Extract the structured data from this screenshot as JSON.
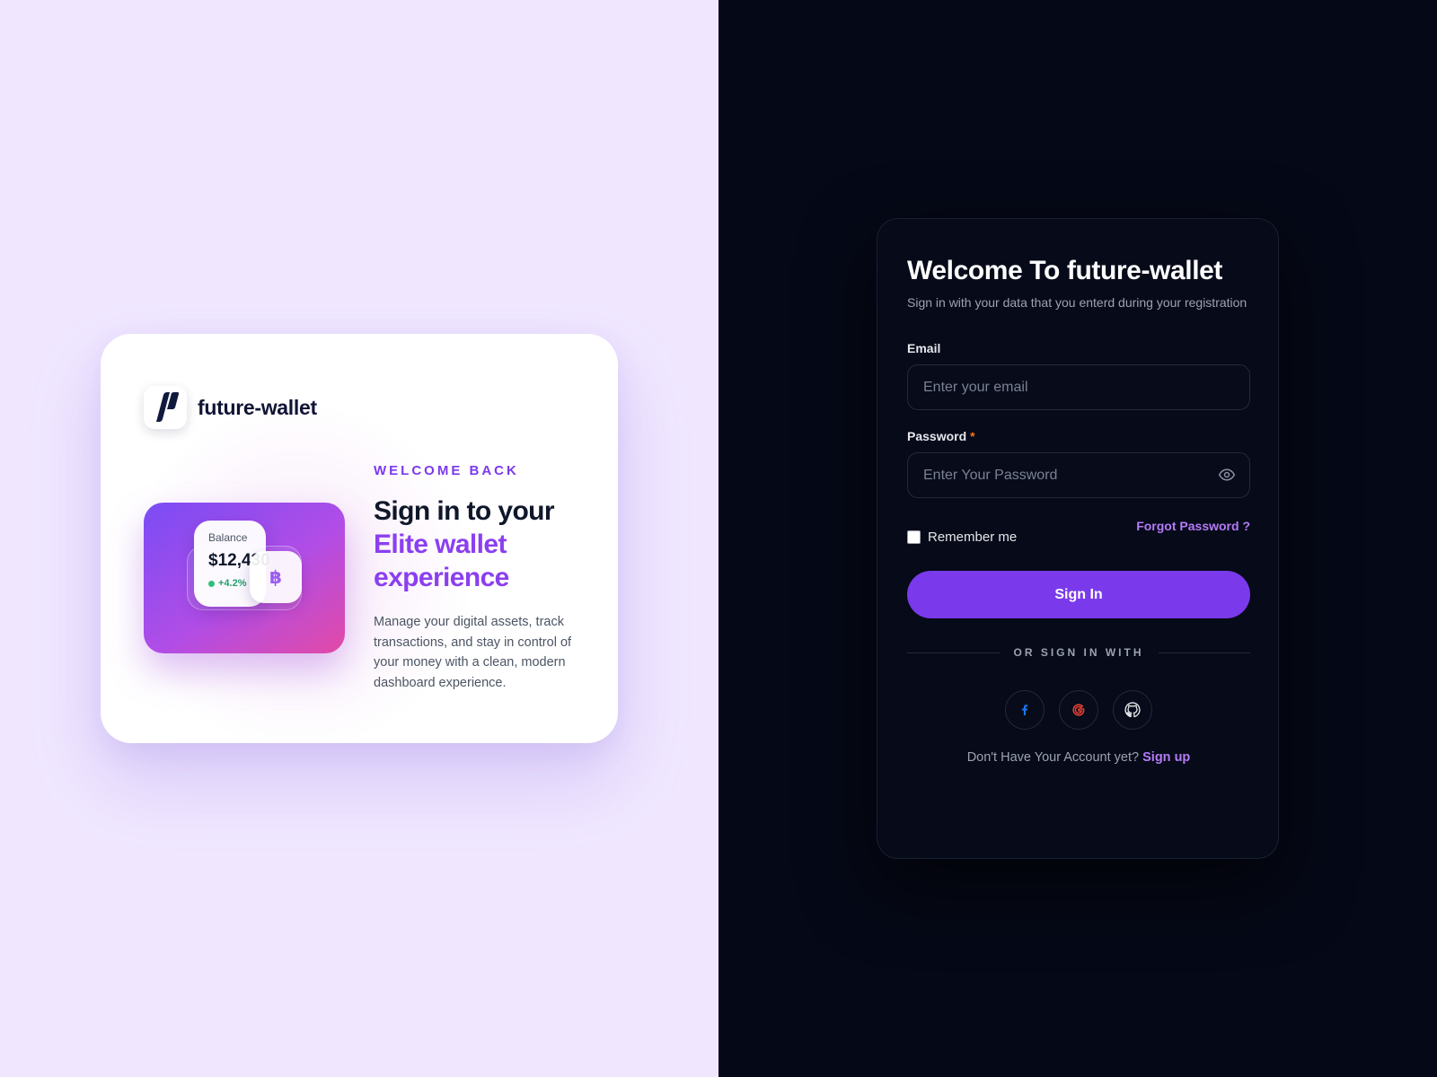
{
  "brand": {
    "name": "future-wallet",
    "logo_icon": "future-wallet-logo-icon"
  },
  "promo": {
    "eyebrow": "WELCOME BACK",
    "title_line1": "Sign in to your",
    "title_accent": "Elite wallet experience",
    "description": "Manage your digital assets, track transactions, and stay in control of your money with a clean, modern dashboard experience.",
    "wallet_card": {
      "balance_label": "Balance",
      "balance_value": "$12,430",
      "change": "+4.2%",
      "coin_symbol": "฿"
    }
  },
  "login": {
    "title": "Welcome To future-wallet",
    "subtitle": "Sign in with your data that you enterd during your registration",
    "email": {
      "label": "Email",
      "placeholder": "Enter your email",
      "value": ""
    },
    "password": {
      "label": "Password",
      "required_marker": "*",
      "placeholder": "Enter Your Password",
      "value": "",
      "toggle_icon": "eye-icon"
    },
    "remember_label": "Remember me",
    "remember_checked": false,
    "forgot_label": "Forgot Password ?",
    "signin_label": "Sign In",
    "divider_text": "OR SIGN IN WITH",
    "social": [
      {
        "name": "facebook",
        "icon": "facebook-icon"
      },
      {
        "name": "google",
        "icon": "google-icon"
      },
      {
        "name": "github",
        "icon": "github-icon"
      }
    ],
    "signup_prompt": "Don't Have Your Account yet?",
    "signup_link": "Sign up"
  },
  "colors": {
    "left_background": "#f0e7ff",
    "right_background": "#050816",
    "accent_purple": "#7a3aeb",
    "link_purple": "#b57bf7",
    "required_orange": "#f97316",
    "positive_green": "#22a06b"
  }
}
